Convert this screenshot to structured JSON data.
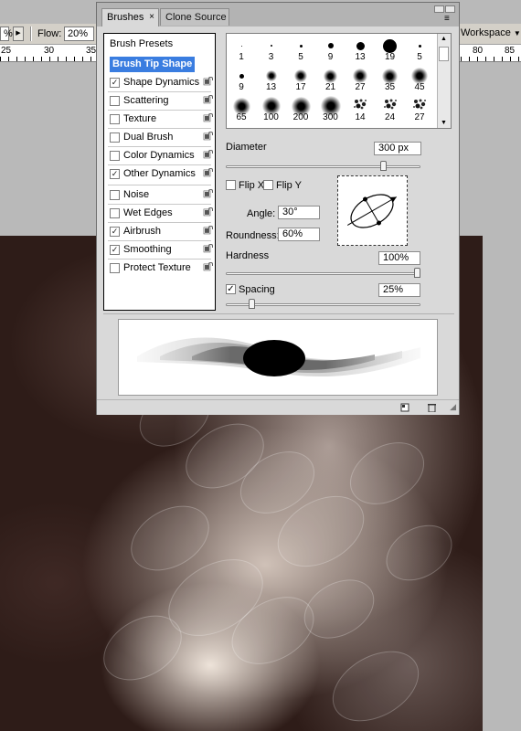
{
  "options_bar": {
    "left_value": "%",
    "flow_label": "Flow:",
    "flow_value": "20%",
    "workspace_label": "Workspace"
  },
  "ruler": {
    "numbers": [
      {
        "label": "25"
      },
      {
        "label": "30"
      },
      {
        "label": "35"
      },
      {
        "label": "80"
      },
      {
        "label": "85"
      }
    ]
  },
  "panel": {
    "tabs": [
      {
        "label": "Brushes",
        "close": "×"
      },
      {
        "label": "Clone Source"
      }
    ],
    "menu_glyph": "≡",
    "list": {
      "header": "Brush Presets",
      "selected": "Brush Tip Shape",
      "items": [
        {
          "label": "Shape Dynamics",
          "checked": true,
          "check": "✓"
        },
        {
          "label": "Scattering",
          "checked": false,
          "check": ""
        },
        {
          "label": "Texture",
          "checked": false,
          "check": ""
        },
        {
          "label": "Dual Brush",
          "checked": false,
          "check": ""
        },
        {
          "label": "Color Dynamics",
          "checked": false,
          "check": ""
        },
        {
          "label": "Other Dynamics",
          "checked": true,
          "check": "✓"
        },
        {
          "label": "Noise",
          "checked": false,
          "check": ""
        },
        {
          "label": "Wet Edges",
          "checked": false,
          "check": ""
        },
        {
          "label": "Airbrush",
          "checked": true,
          "check": "✓"
        },
        {
          "label": "Smoothing",
          "checked": true,
          "check": "✓"
        },
        {
          "label": "Protect Texture",
          "checked": false,
          "check": ""
        }
      ]
    },
    "tips": [
      {
        "size": "1",
        "kind": "hard",
        "d": 1
      },
      {
        "size": "3",
        "kind": "hard",
        "d": 2
      },
      {
        "size": "5",
        "kind": "hard",
        "d": 3
      },
      {
        "size": "9",
        "kind": "hard",
        "d": 6
      },
      {
        "size": "13",
        "kind": "hard",
        "d": 9
      },
      {
        "size": "19",
        "kind": "hard",
        "d": 15
      },
      {
        "size": "5",
        "kind": "hard",
        "d": 3
      },
      {
        "size": "9",
        "kind": "hard",
        "d": 5
      },
      {
        "size": "13",
        "kind": "soft",
        "d": 8
      },
      {
        "size": "17",
        "kind": "soft",
        "d": 10
      },
      {
        "size": "21",
        "kind": "soft",
        "d": 11
      },
      {
        "size": "27",
        "kind": "soft",
        "d": 12
      },
      {
        "size": "35",
        "kind": "soft",
        "d": 13
      },
      {
        "size": "45",
        "kind": "soft",
        "d": 14
      },
      {
        "size": "65",
        "kind": "soft",
        "d": 15
      },
      {
        "size": "100",
        "kind": "soft",
        "d": 16
      },
      {
        "size": "200",
        "kind": "soft",
        "d": 17
      },
      {
        "size": "300",
        "kind": "soft",
        "d": 18
      },
      {
        "size": "14",
        "kind": "splat",
        "d": 14
      },
      {
        "size": "24",
        "kind": "splat",
        "d": 14
      },
      {
        "size": "27",
        "kind": "splat",
        "d": 14
      },
      {
        "size": "",
        "kind": "splat",
        "d": 14
      },
      {
        "size": "",
        "kind": "splat",
        "d": 14
      },
      {
        "size": "",
        "kind": "splat",
        "d": 14
      },
      {
        "size": "",
        "kind": "splat",
        "d": 14
      },
      {
        "size": "",
        "kind": "splat",
        "d": 14
      },
      {
        "size": "",
        "kind": "splat",
        "d": 14
      }
    ],
    "diameter": {
      "label": "Diameter",
      "value": "300 px",
      "level": 0.82
    },
    "flip_x": {
      "label": "Flip X",
      "checked": false
    },
    "flip_y": {
      "label": "Flip Y",
      "checked": false
    },
    "angle": {
      "label": "Angle:",
      "value": "30°"
    },
    "roundness": {
      "label": "Roundness:",
      "value": "60%"
    },
    "hardness": {
      "label": "Hardness",
      "value": "100%",
      "level": 1.0
    },
    "spacing": {
      "label": "Spacing",
      "value": "25%",
      "checked": true,
      "check": "✓",
      "level": 0.12
    }
  },
  "colors": {
    "selection": "#3a7de0",
    "canvas_dark": "#2e1c18"
  }
}
